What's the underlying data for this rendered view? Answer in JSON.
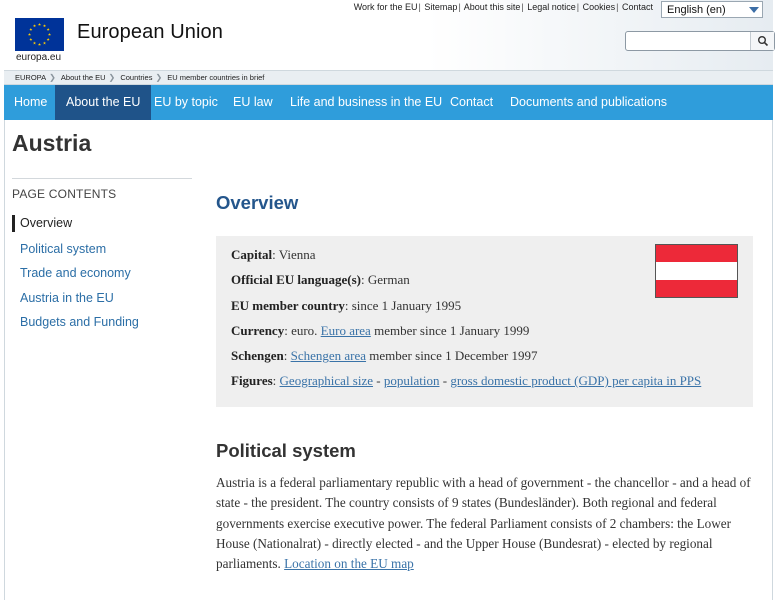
{
  "header": {
    "site_title": "European Union",
    "logo_sub": "europa.eu",
    "top_links": [
      "Work for the EU",
      "Sitemap",
      "About this site",
      "Legal notice",
      "Cookies",
      "Contact"
    ],
    "language": "English (en)"
  },
  "breadcrumb": [
    "EUROPA",
    "About the EU",
    "Countries",
    "EU member countries in brief"
  ],
  "nav": {
    "items": [
      "Home",
      "About the EU",
      "EU by topic",
      "EU law",
      "Life and business in the EU",
      "Contact",
      "Documents and publications"
    ],
    "active": "About the EU"
  },
  "page": {
    "title": "Austria"
  },
  "toc": {
    "heading": "PAGE CONTENTS",
    "items": [
      "Overview",
      "Political system",
      "Trade and economy",
      "Austria in the EU",
      "Budgets and Funding"
    ]
  },
  "overview": {
    "heading": "Overview",
    "capital_label": "Capital",
    "capital": ": Vienna",
    "languages_label": "Official EU language(s)",
    "languages": ": German",
    "member_label": "EU member country",
    "member": ": since 1 January 1995",
    "currency_label": "Currency",
    "currency_pre": ": euro. ",
    "currency_link": "Euro area",
    "currency_post": " member since 1 January 1999",
    "schengen_label": "Schengen",
    "schengen_pre": ": ",
    "schengen_link": "Schengen area",
    "schengen_post": " member since 1 December 1997",
    "figures_label": "Figures",
    "figures_pre": ": ",
    "figures_link1": "Geographical size",
    "figures_sep1": " - ",
    "figures_link2": "population",
    "figures_sep2": " - ",
    "figures_link3": "gross domestic product (GDP) per capita in PPS",
    "flag_colors": [
      "#ed2939",
      "#ffffff",
      "#ed2939"
    ]
  },
  "political": {
    "heading": "Political system",
    "text": "Austria is a federal parliamentary republic with a head of government - the chancellor - and a head of state - the president. The country consists of 9 states (Bundesländer).  Both regional and federal governments exercise executive power. The federal Parliament consists of 2 chambers: the Lower House (Nationalrat) - directly elected - and the Upper House (Bundesrat) - elected by regional parliaments. ",
    "link": "Location on the EU map"
  },
  "colors": {
    "nav_bg": "#2f9ddb",
    "nav_active": "#1f5389",
    "link": "#2b6ea6",
    "eu_blue": "#003399",
    "eu_gold": "#ffcc00"
  },
  "icons": {
    "search": "search-icon",
    "dropdown": "chevron-down-icon",
    "flag": "eu-flag-logo"
  }
}
